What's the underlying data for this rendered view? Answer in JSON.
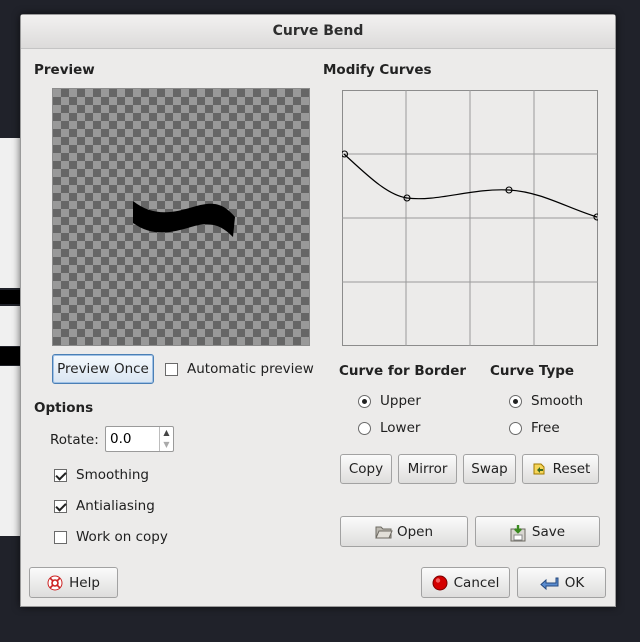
{
  "window": {
    "title": "Curve Bend"
  },
  "preview": {
    "section_title": "Preview",
    "preview_once_label": "Preview Once",
    "automatic_preview_label": "Automatic preview",
    "automatic_preview_checked": false
  },
  "curves": {
    "section_title": "Modify Curves",
    "border_title": "Curve for Border",
    "border_options": [
      "Upper",
      "Lower"
    ],
    "border_selected": "Upper",
    "type_title": "Curve Type",
    "type_options": [
      "Smooth",
      "Free"
    ],
    "type_selected": "Smooth"
  },
  "options": {
    "section_title": "Options",
    "rotate_label": "Rotate:",
    "rotate_value": "0.0",
    "smoothing_label": "Smoothing",
    "smoothing_checked": true,
    "antialiasing_label": "Antialiasing",
    "antialiasing_checked": true,
    "work_on_copy_label": "Work on copy",
    "work_on_copy_checked": false
  },
  "curve_buttons": {
    "copy": "Copy",
    "mirror": "Mirror",
    "swap": "Swap",
    "reset": "Reset",
    "open": "Open",
    "save": "Save"
  },
  "footer": {
    "help": "Help",
    "cancel": "Cancel",
    "ok": "OK"
  },
  "colors": {
    "dialog_bg": "#ecebea",
    "cancel_icon": "#d40000",
    "ok_icon": "#3465a4"
  },
  "icons": [
    "help-icon",
    "cancel-icon",
    "ok-icon",
    "open-folder-icon",
    "save-icon",
    "reset-icon"
  ]
}
